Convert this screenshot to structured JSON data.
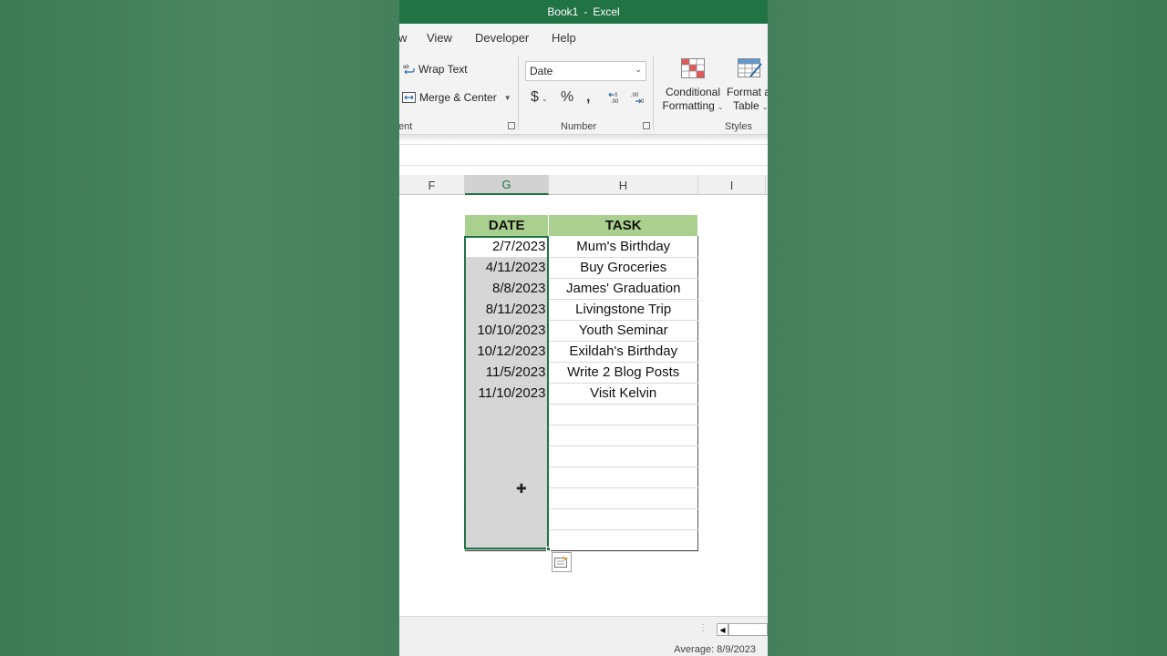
{
  "window": {
    "title_doc": "Book1",
    "title_sep": "-",
    "title_app": "Excel"
  },
  "tabs": [
    "w",
    "View",
    "Developer",
    "Help"
  ],
  "ribbon": {
    "wrap_text": "Wrap Text",
    "merge_center": "Merge & Center",
    "alignment_group_partial": "ent",
    "number_format_value": "Date",
    "currency_symbol": "$",
    "percent_symbol": "%",
    "comma_symbol": ",",
    "number_group": "Number",
    "conditional_formatting_line1": "Conditional",
    "conditional_formatting_line2": "Formatting",
    "format_table_line1": "Format a",
    "format_table_line2": "Table",
    "styles_group": "Styles"
  },
  "columns": [
    "F",
    "G",
    "H",
    "I"
  ],
  "selected_column": "G",
  "table": {
    "headers": {
      "date": "DATE",
      "task": "TASK"
    },
    "rows": [
      {
        "date": "2/7/2023",
        "task": "Mum's Birthday"
      },
      {
        "date": "4/11/2023",
        "task": "Buy Groceries"
      },
      {
        "date": "8/8/2023",
        "task": "James' Graduation"
      },
      {
        "date": "8/11/2023",
        "task": "Livingstone Trip"
      },
      {
        "date": "10/10/2023",
        "task": "Youth Seminar"
      },
      {
        "date": "10/12/2023",
        "task": "Exildah's Birthday"
      },
      {
        "date": "11/5/2023",
        "task": "Write 2 Blog Posts"
      },
      {
        "date": "11/10/2023",
        "task": "Visit Kelvin"
      },
      {
        "date": "",
        "task": ""
      },
      {
        "date": "",
        "task": ""
      },
      {
        "date": "",
        "task": ""
      },
      {
        "date": "",
        "task": ""
      },
      {
        "date": "",
        "task": ""
      },
      {
        "date": "",
        "task": ""
      },
      {
        "date": "",
        "task": ""
      }
    ]
  },
  "status_bar": {
    "average": "Average: 8/9/2023"
  },
  "colors": {
    "excel_green": "#217346",
    "header_fill": "#a9d08e",
    "selection_fill": "#d6d6d6"
  },
  "icons": [
    "wrap-text-icon",
    "merge-center-icon",
    "conditional-formatting-icon",
    "format-as-table-icon",
    "quick-analysis-icon",
    "cell-cursor-icon"
  ]
}
